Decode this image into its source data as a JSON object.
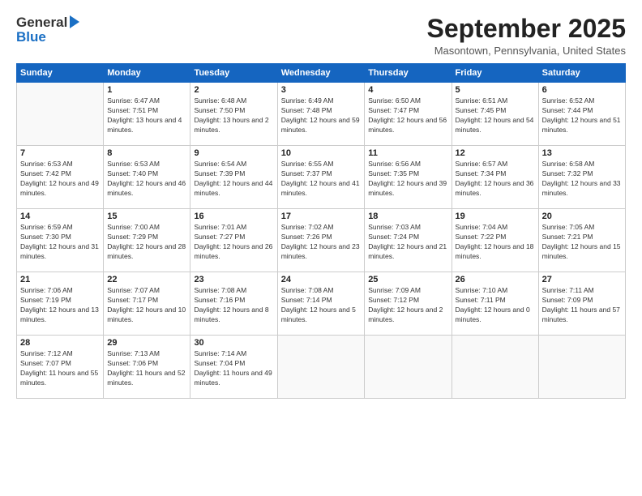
{
  "header": {
    "logo_general": "General",
    "logo_blue": "Blue",
    "month_title": "September 2025",
    "location": "Masontown, Pennsylvania, United States"
  },
  "days_of_week": [
    "Sunday",
    "Monday",
    "Tuesday",
    "Wednesday",
    "Thursday",
    "Friday",
    "Saturday"
  ],
  "weeks": [
    [
      {
        "day": "",
        "sunrise": "",
        "sunset": "",
        "daylight": ""
      },
      {
        "day": "1",
        "sunrise": "Sunrise: 6:47 AM",
        "sunset": "Sunset: 7:51 PM",
        "daylight": "Daylight: 13 hours and 4 minutes."
      },
      {
        "day": "2",
        "sunrise": "Sunrise: 6:48 AM",
        "sunset": "Sunset: 7:50 PM",
        "daylight": "Daylight: 13 hours and 2 minutes."
      },
      {
        "day": "3",
        "sunrise": "Sunrise: 6:49 AM",
        "sunset": "Sunset: 7:48 PM",
        "daylight": "Daylight: 12 hours and 59 minutes."
      },
      {
        "day": "4",
        "sunrise": "Sunrise: 6:50 AM",
        "sunset": "Sunset: 7:47 PM",
        "daylight": "Daylight: 12 hours and 56 minutes."
      },
      {
        "day": "5",
        "sunrise": "Sunrise: 6:51 AM",
        "sunset": "Sunset: 7:45 PM",
        "daylight": "Daylight: 12 hours and 54 minutes."
      },
      {
        "day": "6",
        "sunrise": "Sunrise: 6:52 AM",
        "sunset": "Sunset: 7:44 PM",
        "daylight": "Daylight: 12 hours and 51 minutes."
      }
    ],
    [
      {
        "day": "7",
        "sunrise": "Sunrise: 6:53 AM",
        "sunset": "Sunset: 7:42 PM",
        "daylight": "Daylight: 12 hours and 49 minutes."
      },
      {
        "day": "8",
        "sunrise": "Sunrise: 6:53 AM",
        "sunset": "Sunset: 7:40 PM",
        "daylight": "Daylight: 12 hours and 46 minutes."
      },
      {
        "day": "9",
        "sunrise": "Sunrise: 6:54 AM",
        "sunset": "Sunset: 7:39 PM",
        "daylight": "Daylight: 12 hours and 44 minutes."
      },
      {
        "day": "10",
        "sunrise": "Sunrise: 6:55 AM",
        "sunset": "Sunset: 7:37 PM",
        "daylight": "Daylight: 12 hours and 41 minutes."
      },
      {
        "day": "11",
        "sunrise": "Sunrise: 6:56 AM",
        "sunset": "Sunset: 7:35 PM",
        "daylight": "Daylight: 12 hours and 39 minutes."
      },
      {
        "day": "12",
        "sunrise": "Sunrise: 6:57 AM",
        "sunset": "Sunset: 7:34 PM",
        "daylight": "Daylight: 12 hours and 36 minutes."
      },
      {
        "day": "13",
        "sunrise": "Sunrise: 6:58 AM",
        "sunset": "Sunset: 7:32 PM",
        "daylight": "Daylight: 12 hours and 33 minutes."
      }
    ],
    [
      {
        "day": "14",
        "sunrise": "Sunrise: 6:59 AM",
        "sunset": "Sunset: 7:30 PM",
        "daylight": "Daylight: 12 hours and 31 minutes."
      },
      {
        "day": "15",
        "sunrise": "Sunrise: 7:00 AM",
        "sunset": "Sunset: 7:29 PM",
        "daylight": "Daylight: 12 hours and 28 minutes."
      },
      {
        "day": "16",
        "sunrise": "Sunrise: 7:01 AM",
        "sunset": "Sunset: 7:27 PM",
        "daylight": "Daylight: 12 hours and 26 minutes."
      },
      {
        "day": "17",
        "sunrise": "Sunrise: 7:02 AM",
        "sunset": "Sunset: 7:26 PM",
        "daylight": "Daylight: 12 hours and 23 minutes."
      },
      {
        "day": "18",
        "sunrise": "Sunrise: 7:03 AM",
        "sunset": "Sunset: 7:24 PM",
        "daylight": "Daylight: 12 hours and 21 minutes."
      },
      {
        "day": "19",
        "sunrise": "Sunrise: 7:04 AM",
        "sunset": "Sunset: 7:22 PM",
        "daylight": "Daylight: 12 hours and 18 minutes."
      },
      {
        "day": "20",
        "sunrise": "Sunrise: 7:05 AM",
        "sunset": "Sunset: 7:21 PM",
        "daylight": "Daylight: 12 hours and 15 minutes."
      }
    ],
    [
      {
        "day": "21",
        "sunrise": "Sunrise: 7:06 AM",
        "sunset": "Sunset: 7:19 PM",
        "daylight": "Daylight: 12 hours and 13 minutes."
      },
      {
        "day": "22",
        "sunrise": "Sunrise: 7:07 AM",
        "sunset": "Sunset: 7:17 PM",
        "daylight": "Daylight: 12 hours and 10 minutes."
      },
      {
        "day": "23",
        "sunrise": "Sunrise: 7:08 AM",
        "sunset": "Sunset: 7:16 PM",
        "daylight": "Daylight: 12 hours and 8 minutes."
      },
      {
        "day": "24",
        "sunrise": "Sunrise: 7:08 AM",
        "sunset": "Sunset: 7:14 PM",
        "daylight": "Daylight: 12 hours and 5 minutes."
      },
      {
        "day": "25",
        "sunrise": "Sunrise: 7:09 AM",
        "sunset": "Sunset: 7:12 PM",
        "daylight": "Daylight: 12 hours and 2 minutes."
      },
      {
        "day": "26",
        "sunrise": "Sunrise: 7:10 AM",
        "sunset": "Sunset: 7:11 PM",
        "daylight": "Daylight: 12 hours and 0 minutes."
      },
      {
        "day": "27",
        "sunrise": "Sunrise: 7:11 AM",
        "sunset": "Sunset: 7:09 PM",
        "daylight": "Daylight: 11 hours and 57 minutes."
      }
    ],
    [
      {
        "day": "28",
        "sunrise": "Sunrise: 7:12 AM",
        "sunset": "Sunset: 7:07 PM",
        "daylight": "Daylight: 11 hours and 55 minutes."
      },
      {
        "day": "29",
        "sunrise": "Sunrise: 7:13 AM",
        "sunset": "Sunset: 7:06 PM",
        "daylight": "Daylight: 11 hours and 52 minutes."
      },
      {
        "day": "30",
        "sunrise": "Sunrise: 7:14 AM",
        "sunset": "Sunset: 7:04 PM",
        "daylight": "Daylight: 11 hours and 49 minutes."
      },
      {
        "day": "",
        "sunrise": "",
        "sunset": "",
        "daylight": ""
      },
      {
        "day": "",
        "sunrise": "",
        "sunset": "",
        "daylight": ""
      },
      {
        "day": "",
        "sunrise": "",
        "sunset": "",
        "daylight": ""
      },
      {
        "day": "",
        "sunrise": "",
        "sunset": "",
        "daylight": ""
      }
    ]
  ]
}
